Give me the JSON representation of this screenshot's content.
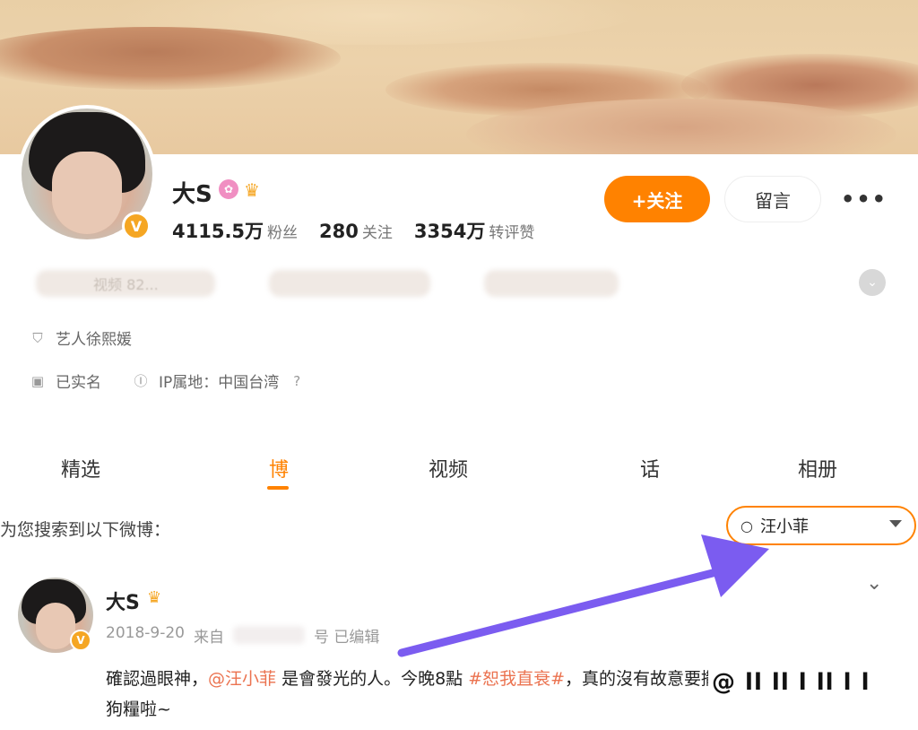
{
  "profile": {
    "name": "大S",
    "verified_badge": "V",
    "stats": [
      {
        "value": "4115.5万",
        "label": "粉丝"
      },
      {
        "value": "280",
        "label": "关注"
      },
      {
        "value": "3354万",
        "label": "转评赞"
      }
    ],
    "follow_label": "+关注",
    "message_label": "留言",
    "more_label": "•••",
    "blurred_snippet": "视频 82...",
    "occupation": "艺人徐熙媛",
    "realname": "已实名",
    "ip_location": "IP属地：中国台湾",
    "help_icon": "?"
  },
  "tabs": [
    {
      "label": "精选",
      "active": false
    },
    {
      "label": "博",
      "active": true
    },
    {
      "label": "视频",
      "active": false
    },
    {
      "label": "话",
      "active": false
    },
    {
      "label": "相册",
      "active": false
    }
  ],
  "search": {
    "caption": "为您搜索到以下微博：",
    "query": "汪小菲"
  },
  "post": {
    "author": "大S",
    "date": "2018-9-20",
    "source_prefix": "来自",
    "source_suffix": "号 已编辑",
    "text_1": "確認過眼神，",
    "mention": "@汪小菲",
    "text_2": " 是會發光的人。今晚8點 ",
    "topic": "#恕我直衰#",
    "text_3": "，真的沒有故意要撒",
    "text_4": "狗糧啦~"
  },
  "overlay": {
    "watermark": "@ ll ll l ll l l"
  },
  "colors": {
    "accent": "#ff8200",
    "link": "#eb7350",
    "arrow": "#7b5cf0"
  }
}
